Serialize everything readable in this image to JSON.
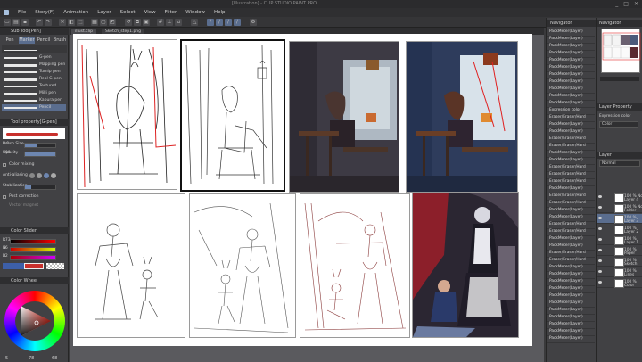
{
  "window": {
    "title": "[Illustration] - CLIP STUDIO PAINT PRO",
    "controls": [
      "_",
      "□",
      "✕"
    ]
  },
  "menu": [
    "File",
    "Story(F)",
    "Animation",
    "Layer",
    "Select",
    "View",
    "Filter",
    "Window",
    "Help"
  ],
  "doc_tabs": [
    "illust.clip",
    "Sketch_step1.png"
  ],
  "left_panel": {
    "tool_header": "Sub Tool[Pen]",
    "tool_tabs": [
      "Pen",
      "Marker",
      "Pencil",
      "Brush"
    ],
    "brushes": [
      "",
      "G-pen",
      "Mapping pen",
      "Turnip pen",
      "Real G-pen",
      "Textured",
      "Milli pen",
      "Kabura pen",
      "Pencil"
    ],
    "tool_property_header": "Tool property[G-pen]",
    "brush_size_label": "Brush Size",
    "brush_size_value": "8.0",
    "opacity_label": "Opacity",
    "opacity_value": "100",
    "color_label": "Color mixing",
    "antialias_label": "Anti-aliasing",
    "stabilization_label": "Stabilization",
    "post_correction_label": "Post correction",
    "vector_label": "Vector magnet",
    "color_slider_header": "Color Slider",
    "rgb": [
      {
        "label": "R",
        "value": "173"
      },
      {
        "label": "G",
        "value": "36"
      },
      {
        "label": "B",
        "value": "32"
      }
    ],
    "color_wheel_header": "Color Wheel",
    "hue_value": "5",
    "sat_value": "78",
    "val_value": "68"
  },
  "navigator": {
    "header": "Navigator",
    "layer_header": "Layer Property",
    "fx_label": "Expression color",
    "fx_value": "Color"
  },
  "layers": [
    "PackMeter(Layer)",
    "PackMeter(Layer)",
    "PackMeter(Layer)",
    "PackMeter(Layer)",
    "PackMeter(Layer)",
    "PackMeter(Layer)",
    "PackMeter(Layer)",
    "PackMeter(Layer)",
    "PackMeter(Layer)",
    "PackMeter(Layer)",
    "PackMeter(Layer)",
    "Expression color",
    "Eraser/Eraser/Hard",
    "PackMeter(Layer)",
    "PackMeter(Layer)",
    "Eraser/Eraser/Hard",
    "Eraser/Eraser/Hard",
    "PackMeter(Layer)",
    "PackMeter(Layer)",
    "Eraser/Eraser/Hard",
    "Eraser/Eraser/Hard",
    "Eraser/Eraser/Hard",
    "PackMeter(Layer)",
    "Eraser/Eraser/Hard",
    "Eraser/Eraser/Hard",
    "PackMeter(Layer)",
    "PackMeter(Layer)",
    "Eraser/Eraser/Hard",
    "Eraser/Eraser/Hard",
    "PackMeter(Layer)",
    "PackMeter(Layer)",
    "Eraser/Eraser/Hard",
    "Eraser/Eraser/Hard",
    "PackMeter(Layer)",
    "PackMeter(Layer)",
    "PackMeter(Layer)",
    "PackMeter(Layer)",
    "PackMeter(Layer)",
    "PackMeter(Layer)",
    "PackMeter(Layer)",
    "PackMeter(Layer)",
    "PackMeter(Layer)",
    "PackMeter(Layer)",
    "PackMeter(Layer)"
  ],
  "layer_panel": {
    "header": "Layer",
    "blend": "Normal",
    "rows": [
      {
        "name": "100 % Normal",
        "sub": "Layer 4"
      },
      {
        "name": "100 % Normal",
        "sub": "Folder"
      },
      {
        "name": "100 %",
        "sub": "Layer 3"
      },
      {
        "name": "100 %",
        "sub": "Layer 2"
      },
      {
        "name": "100 %",
        "sub": "Layer 1"
      },
      {
        "name": "100 %",
        "sub": "Paper"
      },
      {
        "name": "100 %",
        "sub": "Sketch"
      },
      {
        "name": "100 %",
        "sub": "Lines"
      },
      {
        "name": "100 %",
        "sub": "Color"
      }
    ]
  },
  "colors": {
    "accent": "#6d86b0",
    "main_color": "#c8302c",
    "panel": "#414144"
  }
}
